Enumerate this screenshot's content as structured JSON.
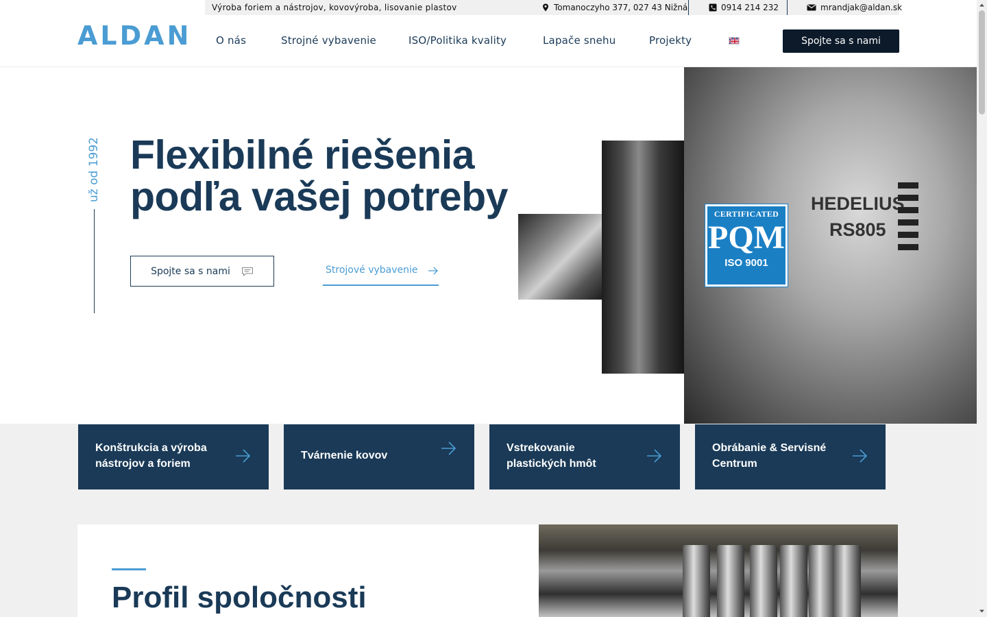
{
  "topbar": {
    "tagline": "Výroba foriem a nástrojov, kovovýroba, lisovanie plastov",
    "address": "Tomanoczyho 377, 027 43 Nižná",
    "phone": "0914 214 232",
    "email": "mrandjak@aldan.sk"
  },
  "header": {
    "logo": "ALDAN",
    "nav": [
      "O nás",
      "Strojné vybavenie",
      "ISO/Politika kvality",
      "Lapače snehu",
      "Projekty"
    ],
    "language_icon": "uk-flag-icon",
    "cta": "Spojte sa s nami"
  },
  "hero": {
    "since": "už od 1992",
    "title_line1": "Flexibilné riešenia",
    "title_line2": "podľa vašej potreby",
    "button_contact": "Spojte sa s nami",
    "button_equipment": "Strojové vybavenie",
    "machine_brand": "HEDELIUS",
    "machine_model": "RS805",
    "certificate": {
      "top": "CERTIFICATED",
      "logo": "PQM",
      "bottom": "ISO 9001"
    }
  },
  "services": [
    {
      "label": "Konštrukcia a výroba nástrojov a foriem"
    },
    {
      "label": "Tvárnenie kovov"
    },
    {
      "label": "Vstrekovanie plastických hmôt"
    },
    {
      "label": "Obrábanie & Servisné Centrum"
    }
  ],
  "profile": {
    "title": "Profil spoločnosti"
  },
  "colors": {
    "primary": "#1a3a57",
    "accent": "#4a9cd3",
    "dark": "#0c1a2a",
    "certificate": "#1b7fc4"
  }
}
